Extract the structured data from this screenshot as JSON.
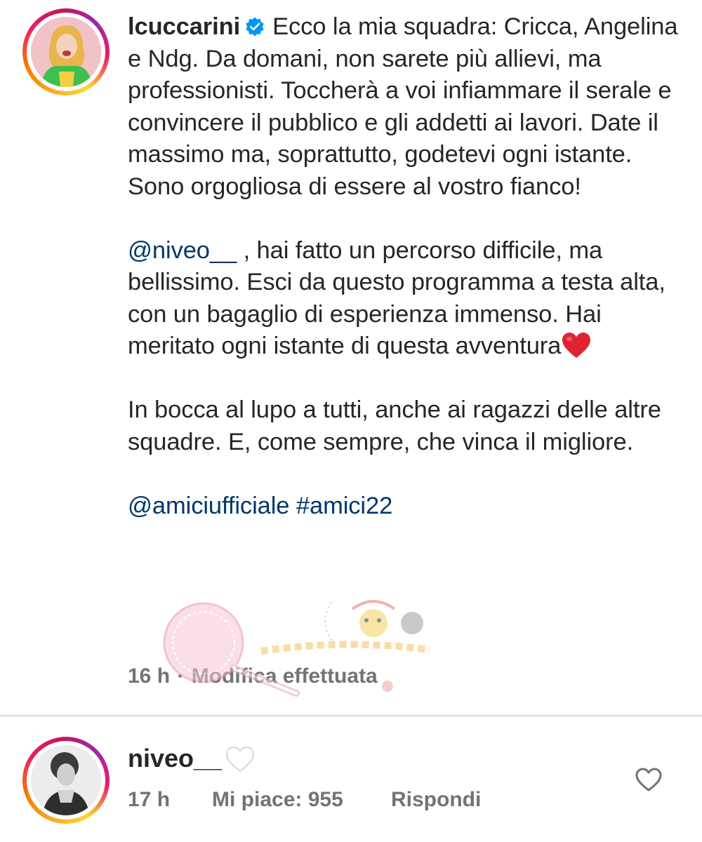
{
  "post": {
    "username": "lcuccarini",
    "caption_intro": "Ecco la mia squadra: Cricca, Angelina e Ndg.",
    "caption_p1": "Da domani, non sarete più allievi, ma professionisti. Toccherà a voi infiammare il serale e convincere il pubblico e gli addetti ai lavori. Date il massimo ma, soprattutto, godetevi ogni istante. Sono orgogliosa di essere al vostro fianco!",
    "mention_1": "@niveo__",
    "caption_p2": " , hai fatto un percorso difficile, ma bellissimo. Esci da questo programma a testa alta, con un bagaglio di esperienza immenso. Hai meritato ogni istante di questa avventura",
    "caption_p3": "In bocca al lupo a tutti, anche ai ragazzi delle altre squadre. E, come sempre, che vinca il migliore.",
    "tag_mention": "@amiciufficiale",
    "tag_hashtag": "#amici22",
    "time": "16 h",
    "dot": "·",
    "edited": "Modifica effettuata"
  },
  "comment": {
    "username": "niveo__",
    "time": "17 h",
    "likes": "Mi piace: 955",
    "reply": "Rispondi"
  },
  "icons": {
    "verified": "verified-badge-icon",
    "red_heart": "red-heart-emoji",
    "white_heart": "white-heart-emoji",
    "like": "heart-outline-icon"
  },
  "colors": {
    "text": "#262626",
    "secondary": "#737373",
    "link": "#00376b",
    "verified": "#0095f6",
    "heart": "#e0242f"
  }
}
